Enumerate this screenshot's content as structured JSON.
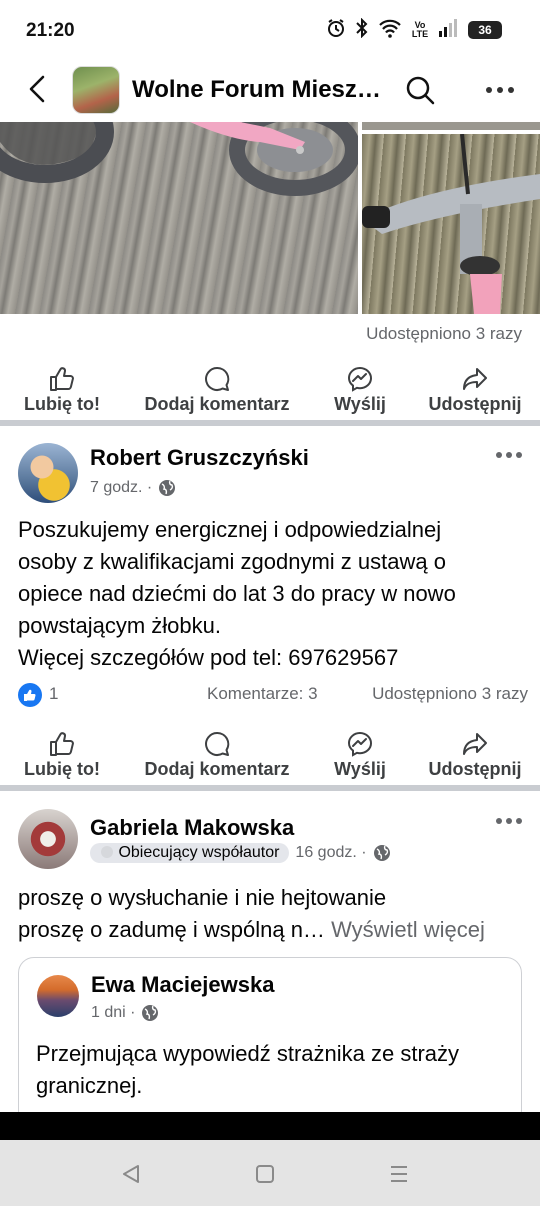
{
  "status_bar": {
    "time": "21:20",
    "network": "Vo LTE",
    "battery": "36",
    "icons": [
      "alarm-icon",
      "bluetooth-icon",
      "wifi-icon",
      "signal-icon",
      "battery-icon"
    ]
  },
  "header": {
    "group_name": "Wolne Forum Miesz…"
  },
  "top_post": {
    "share_count": "Udostępniono 3 razy"
  },
  "actions": {
    "like": "Lubię to!",
    "comment": "Dodaj komentarz",
    "send": "Wyślij",
    "share": "Udostępnij"
  },
  "post_robert": {
    "author": "Robert Gruszczyński",
    "time": "7 godz. ·",
    "text_lines": [
      "Poszukujemy energicznej i odpowiedzialnej",
      "osoby z kwalifikacjami zgodnymi z ustawą o",
      "opiece nad dziećmi do lat 3 do pracy w nowo",
      "powstającym żłobku.",
      "Więcej szczegółów pod tel: 697629567"
    ],
    "reactions": "1",
    "comments": "Komentarze: 3",
    "shares": "Udostępniono 3 razy"
  },
  "post_gabriela": {
    "author": "Gabriela Makowska",
    "badge": "Obiecujący współautor",
    "time": "16 godz. ·",
    "text_line1": "proszę o wysłuchanie i nie hejtowanie",
    "text_line2": "proszę o zadumę i wspólną n…",
    "see_more": "Wyświetl więcej",
    "shared": {
      "author": "Ewa Maciejewska",
      "time": "1 dni ·",
      "text": "Przejmująca wypowiedź strażnika ze straży granicznej."
    }
  },
  "colors": {
    "text_primary": "#050505",
    "text_secondary": "#65676b",
    "divider": "#c9ccd1",
    "like_blue": "#1877f2",
    "nav_bar": "#e4e4e4"
  }
}
